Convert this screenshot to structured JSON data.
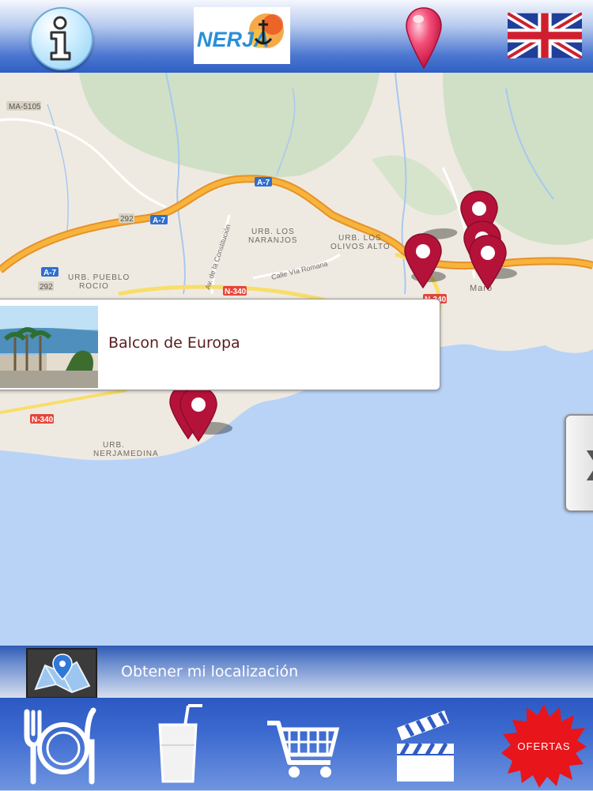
{
  "header": {
    "info_icon": "info-icon",
    "logo_text": "NERJA",
    "locate_icon": "map-pin-icon",
    "language_icon": "uk-flag-icon"
  },
  "map": {
    "road_labels": [
      "MA-5105",
      "A-7",
      "A-7",
      "A-7",
      "292",
      "292",
      "N-340",
      "N-340",
      "N-340"
    ],
    "place_labels": {
      "naranjos_1": "URB. LOS",
      "naranjos_2": "NARANJOS",
      "olivos_1": "URB. LOS",
      "olivos_2": "OLIVOS ALTO",
      "pueblo_1": "URB. PUEBLO",
      "pueblo_2": "ROCIO",
      "nerjamedina_1": "URB.",
      "nerjamedina_2": "NERJAMEDINA",
      "street_1": "Av. de la Constitución",
      "street_2": "Calle Vía Romana",
      "town": "Maro"
    },
    "popup": {
      "title": "Balcon de Europa"
    },
    "side_handle": "❯"
  },
  "location_bar": {
    "label": "Obtener mi localización",
    "icon": "map-location-icon"
  },
  "bottom_nav": {
    "items": [
      {
        "icon": "restaurant-icon"
      },
      {
        "icon": "drink-icon"
      },
      {
        "icon": "shopping-cart-icon"
      },
      {
        "icon": "clapperboard-icon"
      },
      {
        "icon": "ofertas-badge-icon",
        "label": "OFERTAS"
      }
    ]
  },
  "colors": {
    "marker": "#b5123a",
    "sea": "#b9d3f7",
    "land": "#efeae1",
    "highway": "#f3a92f",
    "bar": "#2f5bc4"
  }
}
